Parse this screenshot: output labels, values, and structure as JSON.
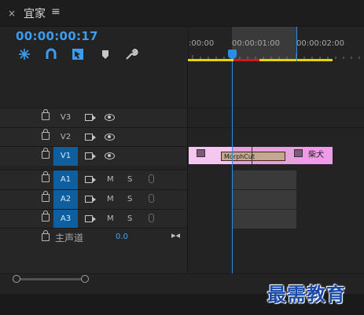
{
  "panel": {
    "close_icon": "×",
    "title": "宜家",
    "menu_icon": "≡"
  },
  "timecode": "00:00:00:17",
  "tools": [
    "snap-icon",
    "magnet-icon",
    "linked-selection-icon",
    "marker-icon",
    "wrench-icon"
  ],
  "ruler": {
    "ticks": [
      ":00:00",
      "00:00:01:00",
      "00:00:02:00"
    ]
  },
  "tracks": [
    {
      "name": "V3",
      "type": "video",
      "targeted": false
    },
    {
      "name": "V2",
      "type": "video",
      "targeted": false
    },
    {
      "name": "V1",
      "type": "video",
      "targeted": true
    },
    {
      "name": "A1",
      "type": "audio",
      "targeted": true,
      "mute": "M",
      "solo": "S"
    },
    {
      "name": "A2",
      "type": "audio",
      "targeted": true,
      "mute": "M",
      "solo": "S"
    },
    {
      "name": "A3",
      "type": "audio",
      "targeted": true,
      "mute": "M",
      "solo": "S"
    }
  ],
  "master": {
    "label": "主声道",
    "value": "0.0"
  },
  "clips": {
    "transition_label": "MorphCut",
    "clip_name": "柴犬"
  },
  "watermark": "最需教育",
  "colors": {
    "accent": "#2b8ce8",
    "clip_pink": "#f09be8",
    "work_area": "#e8d300"
  }
}
